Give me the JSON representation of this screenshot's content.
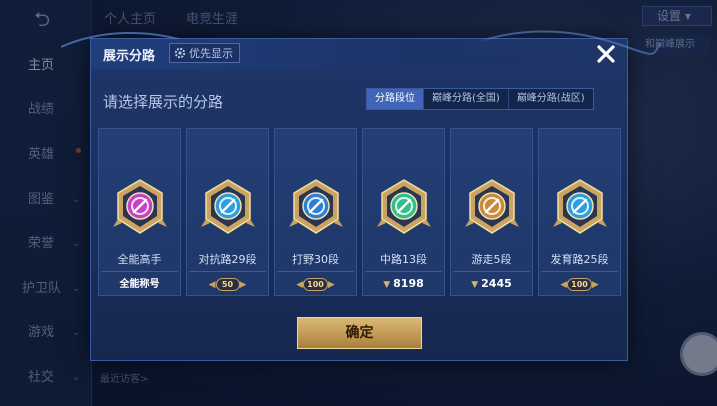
{
  "background": {
    "nav": {
      "items": [
        {
          "label": "主页",
          "active": true
        },
        {
          "label": "战绩",
          "active": false
        },
        {
          "label": "英雄",
          "active": false
        },
        {
          "label": "图鉴",
          "active": false
        },
        {
          "label": "荣誉",
          "active": false
        },
        {
          "label": "护卫队",
          "active": false
        },
        {
          "label": "游戏",
          "active": false
        },
        {
          "label": "社交",
          "active": false
        }
      ]
    },
    "top_tabs": [
      "个人主页",
      "电竞生涯"
    ],
    "settings_label": "设置",
    "tip_text": "和巅峰展示",
    "recent_visitors": "最近访客>"
  },
  "dialog": {
    "title": "展示分路",
    "priority_label": "优先显示",
    "prompt": "请选择展示的分路",
    "segments": [
      {
        "label": "分路段位",
        "active": true
      },
      {
        "label": "巅峰分路(全国)",
        "active": false
      },
      {
        "label": "巅峰分路(战区)",
        "active": false
      }
    ],
    "cards": [
      {
        "name": "全能高手",
        "foot_type": "title",
        "foot_text": "全能称号",
        "emblem": "all-round-emblem",
        "color": "#c640c8"
      },
      {
        "name": "对抗路29段",
        "foot_type": "pill",
        "foot_text": "50",
        "emblem": "clash-lane-emblem",
        "color": "#2a9fe0"
      },
      {
        "name": "打野30段",
        "foot_type": "pill",
        "foot_text": "100",
        "emblem": "jungle-emblem",
        "color": "#2a7fd8"
      },
      {
        "name": "中路13段",
        "foot_type": "score",
        "foot_text": "8198",
        "emblem": "mid-lane-emblem",
        "color": "#2fbf8a"
      },
      {
        "name": "游走5段",
        "foot_type": "score",
        "foot_text": "2445",
        "emblem": "roam-emblem",
        "color": "#c98a3a"
      },
      {
        "name": "发育路25段",
        "foot_type": "pill",
        "foot_text": "100",
        "emblem": "farm-lane-emblem",
        "color": "#2a9fe0"
      }
    ],
    "confirm_label": "确定"
  }
}
